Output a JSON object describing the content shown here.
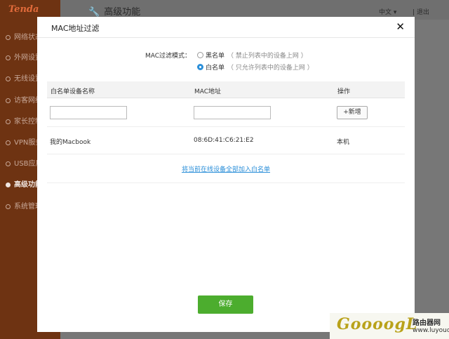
{
  "app": {
    "logo": "Tenda",
    "page_title": "高级功能",
    "lang": "中文",
    "logout": "退出"
  },
  "sidebar": {
    "items": [
      {
        "label": "网络状态",
        "active": false
      },
      {
        "label": "外网设置",
        "active": false
      },
      {
        "label": "无线设置",
        "active": false
      },
      {
        "label": "访客网络",
        "active": false
      },
      {
        "label": "家长控制",
        "active": false
      },
      {
        "label": "VPN服务",
        "active": false
      },
      {
        "label": "USB应用",
        "active": false
      },
      {
        "label": "高级功能",
        "active": true
      },
      {
        "label": "系统管理",
        "active": false
      }
    ]
  },
  "modal": {
    "title": "MAC地址过滤",
    "close": "✕",
    "mode_label": "MAC过滤模式：",
    "modes": [
      {
        "label": "黑名单",
        "note": "（ 禁止列表中的设备上网 ）",
        "checked": false
      },
      {
        "label": "白名单",
        "note": "（ 只允许列表中的设备上网 ）",
        "checked": true
      }
    ],
    "table": {
      "headers": [
        "白名单设备名称",
        "MAC地址",
        "操作"
      ],
      "name_input": {
        "value": "",
        "placeholder": ""
      },
      "mac_input": {
        "value": "",
        "placeholder": ""
      },
      "add_button": "+新增",
      "rows": [
        {
          "name": "我的Macbook",
          "mac": "08:6D:41:C6:21:E2",
          "action": "本机"
        }
      ]
    },
    "add_all_link": "将当前在线设备全部加入白名单",
    "save_button": "保存"
  },
  "watermark": {
    "main": "GoooogL",
    "title": "路由器网",
    "domain": "www.luyouqi.com"
  },
  "colors": {
    "sidebar": "#6e3312",
    "accent_blue": "#2b8fd9",
    "save_green": "#4cad2e"
  }
}
